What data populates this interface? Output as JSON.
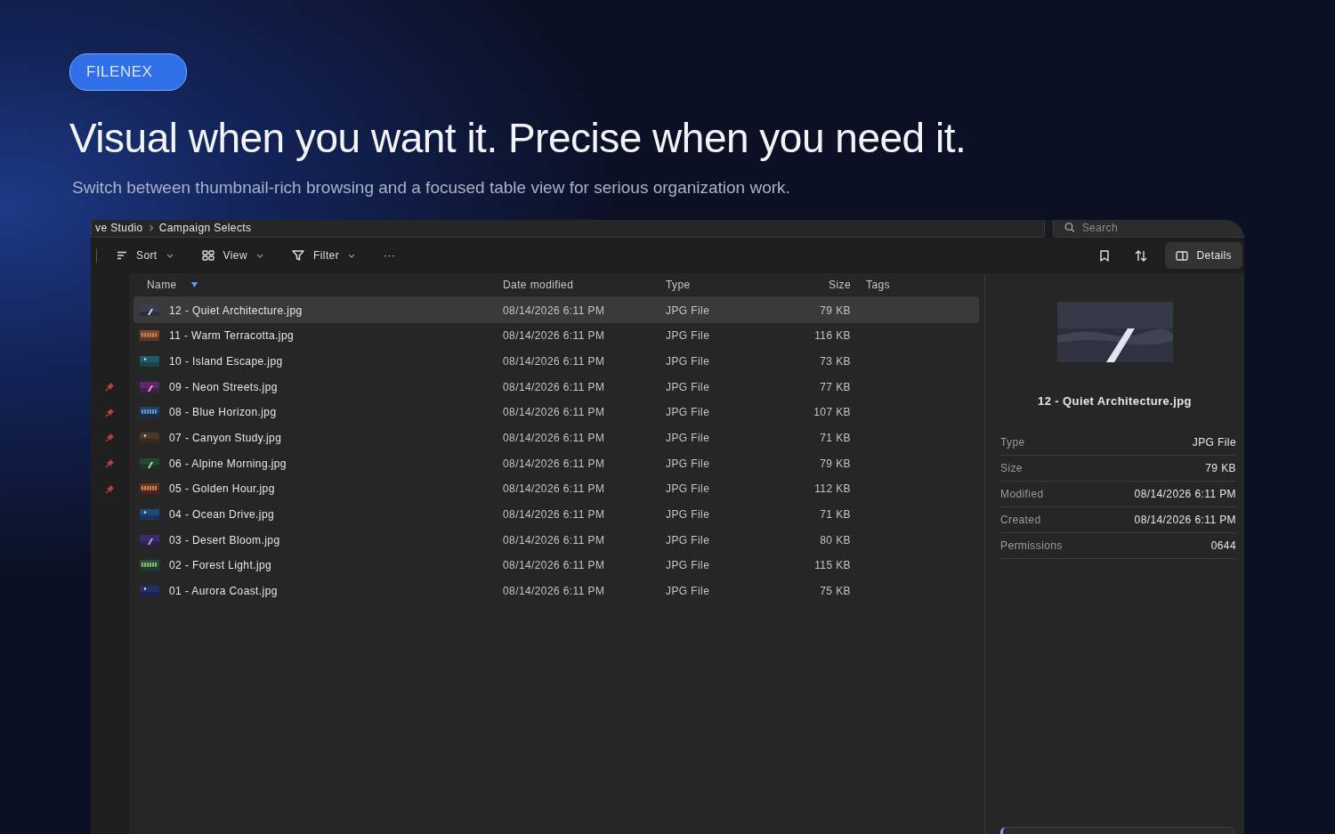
{
  "hero": {
    "badge": "FILENEX",
    "title": "Visual when you want it. Precise when you need it.",
    "subtitle": "Switch between thumbnail-rich browsing and a focused table view for serious organization work."
  },
  "breadcrumbs": [
    "ve Studio",
    "Campaign Selects"
  ],
  "search": {
    "placeholder": "Search"
  },
  "toolbar": {
    "buttons": [
      {
        "kind": "sort",
        "label": "Sort"
      },
      {
        "kind": "view",
        "label": "View"
      },
      {
        "kind": "filter",
        "label": "Filter"
      },
      {
        "kind": "more",
        "label": "···"
      }
    ],
    "details": {
      "label": "Details",
      "on": true
    }
  },
  "table": {
    "columns": [
      {
        "label": "Name",
        "sorted": true
      },
      {
        "label": "Date modified",
        "sorted": false
      },
      {
        "label": "Type",
        "sorted": false
      },
      {
        "label": "Size",
        "sorted": false
      },
      {
        "label": "Tags",
        "sorted": false
      }
    ],
    "rows": [
      {
        "name": "12 - Quiet Architecture.jpg",
        "modified": "08/14/2026 6:11 PM",
        "type": "JPG File",
        "size": "79 KB",
        "selected": true,
        "pinned": false
      },
      {
        "name": "11 - Warm Terracotta.jpg",
        "modified": "08/14/2026 6:11 PM",
        "type": "JPG File",
        "size": "116 KB",
        "selected": false,
        "pinned": false
      },
      {
        "name": "10 - Island Escape.jpg",
        "modified": "08/14/2026 6:11 PM",
        "type": "JPG File",
        "size": "73 KB",
        "selected": false,
        "pinned": false
      },
      {
        "name": "09 - Neon Streets.jpg",
        "modified": "08/14/2026 6:11 PM",
        "type": "JPG File",
        "size": "77 KB",
        "selected": false,
        "pinned": true
      },
      {
        "name": "08 - Blue Horizon.jpg",
        "modified": "08/14/2026 6:11 PM",
        "type": "JPG File",
        "size": "107 KB",
        "selected": false,
        "pinned": true
      },
      {
        "name": "07 - Canyon Study.jpg",
        "modified": "08/14/2026 6:11 PM",
        "type": "JPG File",
        "size": "71 KB",
        "selected": false,
        "pinned": true
      },
      {
        "name": "06 - Alpine Morning.jpg",
        "modified": "08/14/2026 6:11 PM",
        "type": "JPG File",
        "size": "79 KB",
        "selected": false,
        "pinned": true
      },
      {
        "name": "05 - Golden Hour.jpg",
        "modified": "08/14/2026 6:11 PM",
        "type": "JPG File",
        "size": "112 KB",
        "selected": false,
        "pinned": true
      },
      {
        "name": "04 - Ocean Drive.jpg",
        "modified": "08/14/2026 6:11 PM",
        "type": "JPG File",
        "size": "71 KB",
        "selected": false,
        "pinned": false
      },
      {
        "name": "03 - Desert Bloom.jpg",
        "modified": "08/14/2026 6:11 PM",
        "type": "JPG File",
        "size": "80 KB",
        "selected": false,
        "pinned": false
      },
      {
        "name": "02 - Forest Light.jpg",
        "modified": "08/14/2026 6:11 PM",
        "type": "JPG File",
        "size": "115 KB",
        "selected": false,
        "pinned": false
      },
      {
        "name": "01 - Aurora Coast.jpg",
        "modified": "08/14/2026 6:11 PM",
        "type": "JPG File",
        "size": "75 KB",
        "selected": false,
        "pinned": false
      }
    ]
  },
  "details": {
    "name": "12 - Quiet Architecture.jpg",
    "properties": [
      {
        "label": "Type",
        "value": "JPG File"
      },
      {
        "label": "Size",
        "value": "79 KB"
      },
      {
        "label": "Modified",
        "value": "08/14/2026 6:11 PM"
      },
      {
        "label": "Created",
        "value": "08/14/2026 6:11 PM"
      },
      {
        "label": "Permissions",
        "value": "0644"
      }
    ]
  }
}
